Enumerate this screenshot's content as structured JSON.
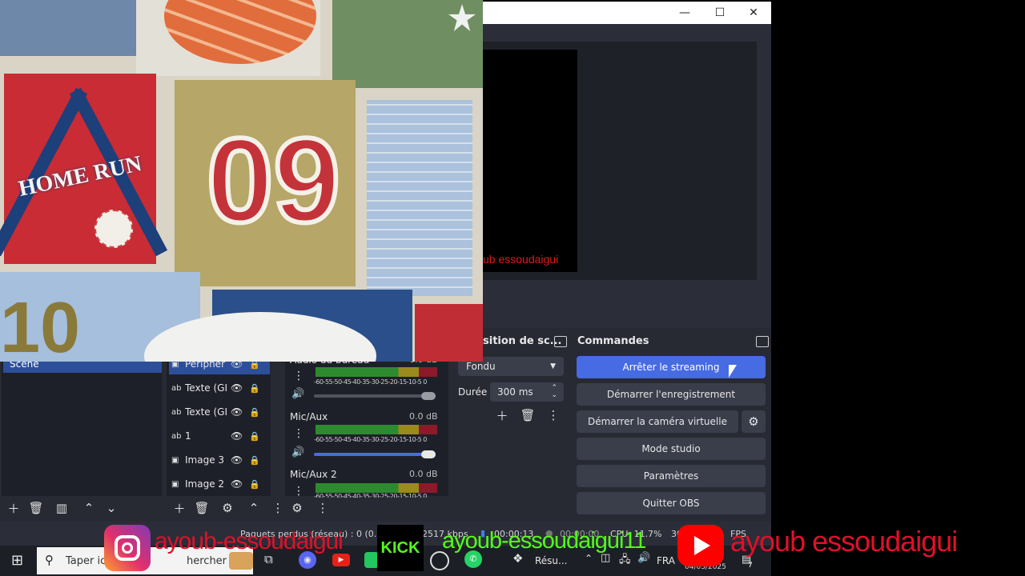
{
  "webcam": {
    "label": "HOME RUN",
    "number": "09"
  },
  "preview": {
    "watermark": "ub essoudaigui"
  },
  "window_controls": {
    "minimize": "—",
    "maximize": "☐",
    "close": "✕"
  },
  "scenes": {
    "selected": "Scène"
  },
  "sources": [
    {
      "icon": "image-icon",
      "glyph": "▣",
      "label": "Périphér"
    },
    {
      "icon": "text-icon",
      "glyph": "ab",
      "label": "Texte (GI"
    },
    {
      "icon": "text-icon",
      "glyph": "ab",
      "label": "Texte (GI"
    },
    {
      "icon": "text-icon",
      "glyph": "ab",
      "label": "1"
    },
    {
      "icon": "image-icon",
      "glyph": "▣",
      "label": "Image 3"
    },
    {
      "icon": "image-icon",
      "glyph": "▣",
      "label": "Image 2"
    }
  ],
  "mixer": {
    "scale": "-60-55-50-45-40-35-30-25-20-15-10-5 0",
    "channels": [
      {
        "name": "Audio du bureau",
        "db": "0.0 dB"
      },
      {
        "name": "Mic/Aux",
        "db": "0.0 dB"
      },
      {
        "name": "Mic/Aux 2",
        "db": "0.0 dB"
      }
    ]
  },
  "transition": {
    "title": "sition de sc...",
    "type": "Fondu",
    "duration_label": "Durée",
    "duration_value": "300 ms"
  },
  "controls": {
    "title": "Commandes",
    "buttons": [
      "Arrêter le streaming",
      "Démarrer l'enregistrement",
      "Démarrer la caméra virtuelle",
      "Mode studio",
      "Paramètres",
      "Quitter OBS"
    ]
  },
  "status": {
    "lost": "Paquets perdus (réseau) : 0 (0.0",
    "kbps": "2517 kbps",
    "time1": "00:00:13",
    "time2": "00:00:00",
    "cpu": "CPU: 11.7%",
    "fps_prefix": "30",
    "fps": "FPS"
  },
  "social": {
    "instagram": "ayoub-essoudaigui",
    "kick_logo": "KICK",
    "kick": "ayoub-essoudaigui11",
    "youtube": "ayoub essoudaigui"
  },
  "taskbar": {
    "search_placeholder": "Taper ic",
    "search_rest": "hercher",
    "app_label": "Résu...",
    "lang": "FRA",
    "date": "04/03/2025",
    "notif_count": "7"
  }
}
